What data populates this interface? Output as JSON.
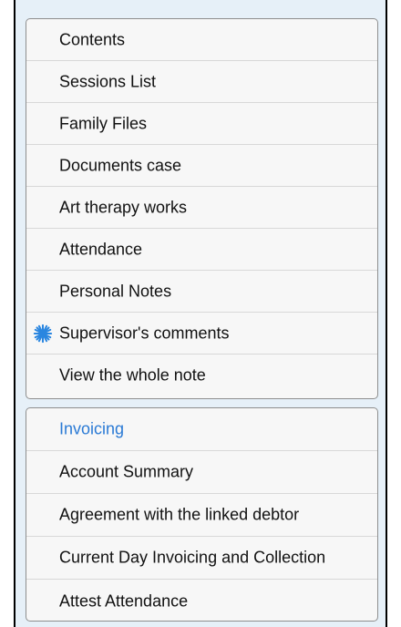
{
  "menu_group_1": {
    "items": [
      {
        "label": "Contents"
      },
      {
        "label": "Sessions List"
      },
      {
        "label": "Family Files"
      },
      {
        "label": "Documents case"
      },
      {
        "label": "Art therapy works"
      },
      {
        "label": "Attendance"
      },
      {
        "label": "Personal Notes"
      },
      {
        "label": "Supervisor's comments",
        "icon": "burst-star-icon",
        "icon_color": "#2a86e0"
      },
      {
        "label": "View the whole note"
      }
    ]
  },
  "menu_group_2": {
    "header": "Invoicing",
    "header_color": "#2a7ad5",
    "items": [
      {
        "label": "Account Summary"
      },
      {
        "label": "Agreement with the linked debtor"
      },
      {
        "label": "Current Day Invoicing and Collection"
      },
      {
        "label": "Attest Attendance"
      }
    ]
  }
}
